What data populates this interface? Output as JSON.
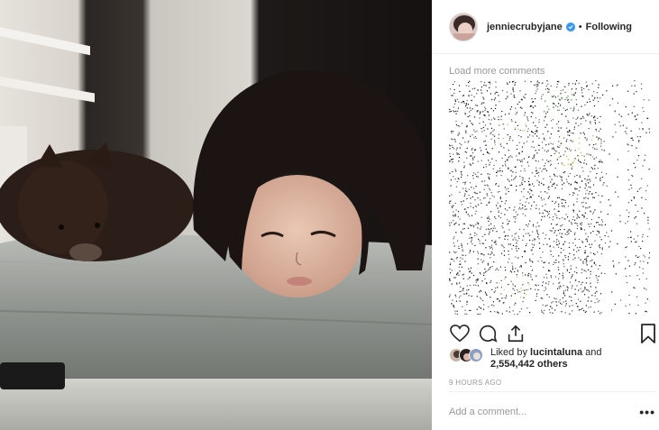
{
  "post": {
    "username": "jenniecrubyjane",
    "verified": true,
    "follow_status": "Following",
    "separator": "•",
    "load_more_label": "Load more comments",
    "liked_by_prefix": "Liked by",
    "liked_by_user": "lucintaluna",
    "liked_by_and": "and",
    "likes_count": "2,554,442 others",
    "timestamp": "9 HOURS AGO",
    "comment_placeholder": "Add a comment...",
    "more_options": "•••"
  },
  "icons": {
    "like": "heart-icon",
    "comment": "comment-bubble-icon",
    "share": "share-icon",
    "save": "bookmark-icon",
    "verified": "verified-badge-icon"
  },
  "colors": {
    "verified_blue": "#3897f0",
    "secondary_text": "#999999",
    "primary_text": "#262626"
  }
}
